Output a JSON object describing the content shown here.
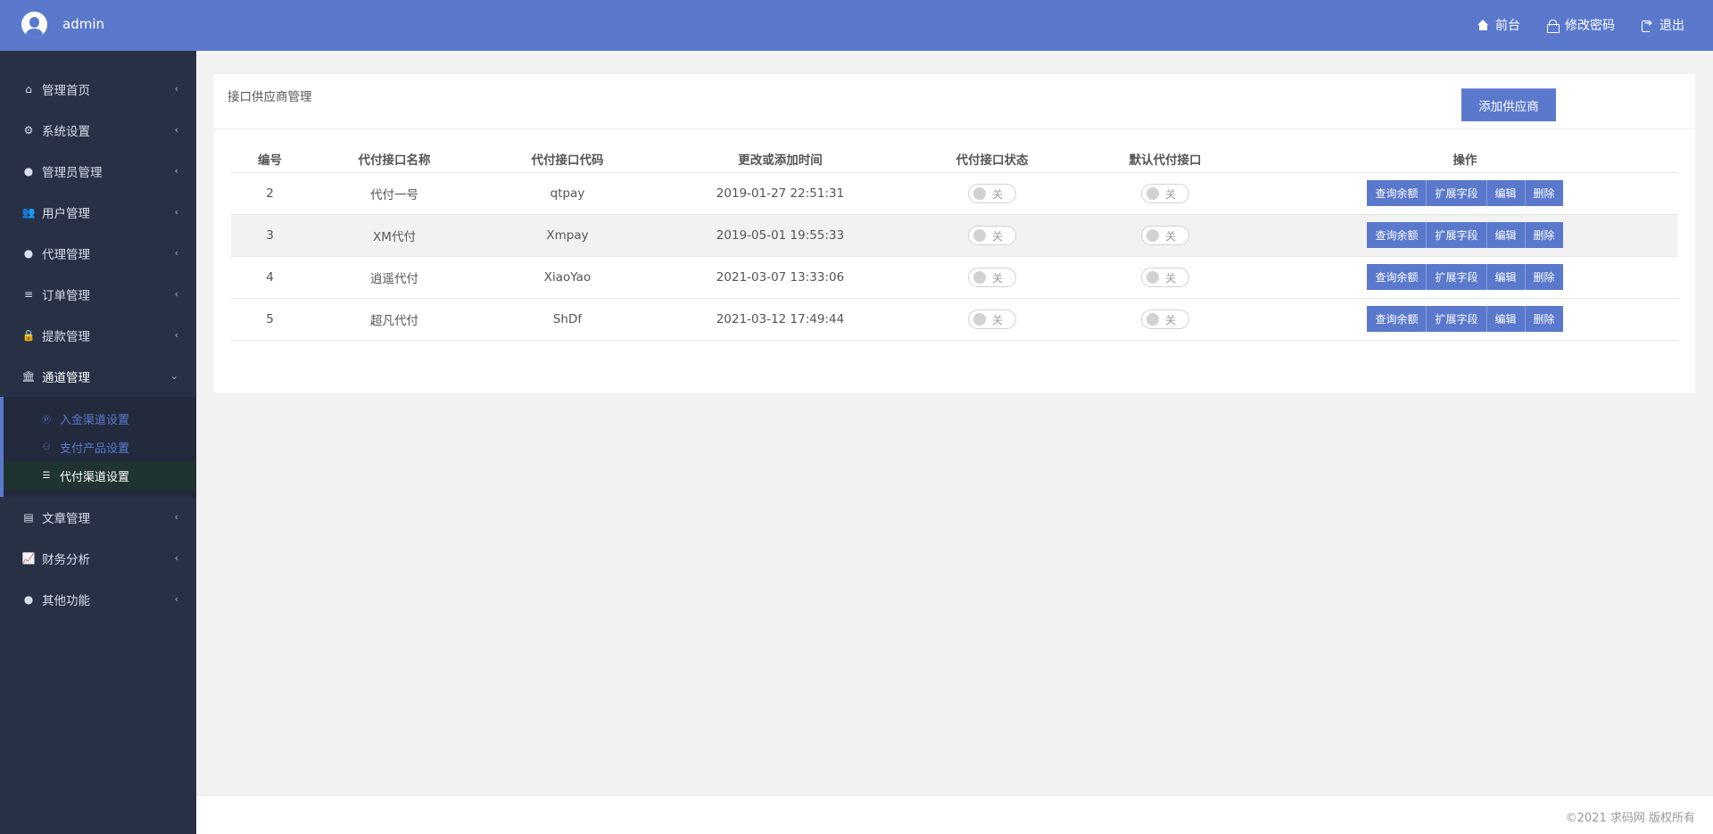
{
  "header": {
    "username": "admin",
    "nav": [
      {
        "label": "前台",
        "icon": "home-icon"
      },
      {
        "label": "修改密码",
        "icon": "lock-icon"
      },
      {
        "label": "退出",
        "icon": "logout-icon"
      }
    ]
  },
  "sidebar": {
    "items": [
      {
        "label": "管理首页",
        "icon": "home-icon"
      },
      {
        "label": "系统设置",
        "icon": "cogs-icon"
      },
      {
        "label": "管理员管理",
        "icon": "user-circle-icon"
      },
      {
        "label": "用户管理",
        "icon": "users-icon"
      },
      {
        "label": "代理管理",
        "icon": "user-circle-icon"
      },
      {
        "label": "订单管理",
        "icon": "list-icon"
      },
      {
        "label": "提款管理",
        "icon": "lock-icon"
      },
      {
        "label": "通道管理",
        "icon": "bank-icon"
      },
      {
        "label": "文章管理",
        "icon": "book-icon"
      },
      {
        "label": "财务分析",
        "icon": "chart-line-icon"
      },
      {
        "label": "其他功能",
        "icon": "user-circle-icon"
      }
    ],
    "submenu": [
      {
        "label": "入金渠道设置",
        "icon": "p-circle-icon"
      },
      {
        "label": "支付产品设置",
        "icon": "sitemap-icon"
      },
      {
        "label": "代付渠道设置",
        "icon": "sliders-icon"
      }
    ]
  },
  "panel": {
    "title": "接口供应商管理",
    "add_button": "添加供应商"
  },
  "table": {
    "headers": [
      "编号",
      "代付接口名称",
      "代付接口代码",
      "更改或添加时间",
      "代付接口状态",
      "默认代付接口",
      "操作"
    ],
    "rows": [
      {
        "id": "2",
        "name": "代付一号",
        "code": "qtpay",
        "time": "2019-01-27 22:51:31",
        "status": "关",
        "default": "关"
      },
      {
        "id": "3",
        "name": "XM代付",
        "code": "Xmpay",
        "time": "2019-05-01 19:55:33",
        "status": "关",
        "default": "关"
      },
      {
        "id": "4",
        "name": "逍遥代付",
        "code": "XiaoYao",
        "time": "2021-03-07 13:33:06",
        "status": "关",
        "default": "关"
      },
      {
        "id": "5",
        "name": "超凡代付",
        "code": "ShDf",
        "time": "2021-03-12 17:49:44",
        "status": "关",
        "default": "关"
      }
    ],
    "ops": [
      "查询余额",
      "扩展字段",
      "编辑",
      "删除"
    ]
  },
  "footer": {
    "copyright": "©2021 求码网 版权所有"
  },
  "colors": {
    "accent": "#5a79cc",
    "sidebar_bg": "#283046",
    "page_bg": "#f2f2f2"
  }
}
